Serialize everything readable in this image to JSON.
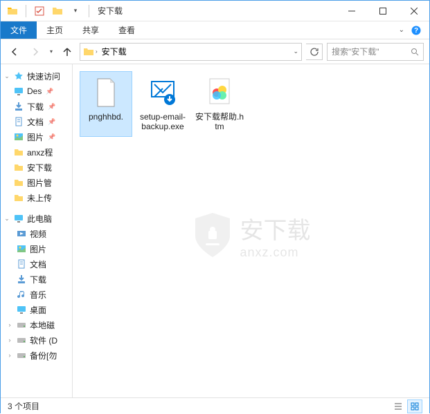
{
  "window": {
    "title": "安下载"
  },
  "ribbon": {
    "file": "文件",
    "home": "主页",
    "share": "共享",
    "view": "查看"
  },
  "address": {
    "current": "安下载"
  },
  "search": {
    "placeholder": "搜索\"安下载\""
  },
  "sidebar": {
    "quickaccess": "快速访问",
    "items_qa": [
      {
        "label": "Des",
        "icon": "desktop"
      },
      {
        "label": "下载",
        "icon": "downloads"
      },
      {
        "label": "文档",
        "icon": "documents"
      },
      {
        "label": "图片",
        "icon": "pictures"
      },
      {
        "label": "anxz程",
        "icon": "folder"
      },
      {
        "label": "安下载",
        "icon": "folder"
      },
      {
        "label": "图片管",
        "icon": "folder"
      },
      {
        "label": "未上传",
        "icon": "folder"
      }
    ],
    "thispc": "此电脑",
    "items_pc": [
      {
        "label": "视频",
        "icon": "videos"
      },
      {
        "label": "图片",
        "icon": "pictures"
      },
      {
        "label": "文档",
        "icon": "documents"
      },
      {
        "label": "下载",
        "icon": "downloads"
      },
      {
        "label": "音乐",
        "icon": "music"
      },
      {
        "label": "桌面",
        "icon": "desktop"
      },
      {
        "label": "本地磁",
        "icon": "disk"
      },
      {
        "label": "软件 (D",
        "icon": "disk"
      },
      {
        "label": "备份[勿",
        "icon": "disk"
      }
    ]
  },
  "files": [
    {
      "label": "pnghhbd.",
      "type": "file"
    },
    {
      "label": "setup-email-backup.exe",
      "type": "exe"
    },
    {
      "label": "安下载帮助.htm",
      "type": "htm"
    }
  ],
  "status": {
    "count": "3 个项目"
  },
  "watermark": {
    "zh": "安下载",
    "en": "anxz.com"
  }
}
